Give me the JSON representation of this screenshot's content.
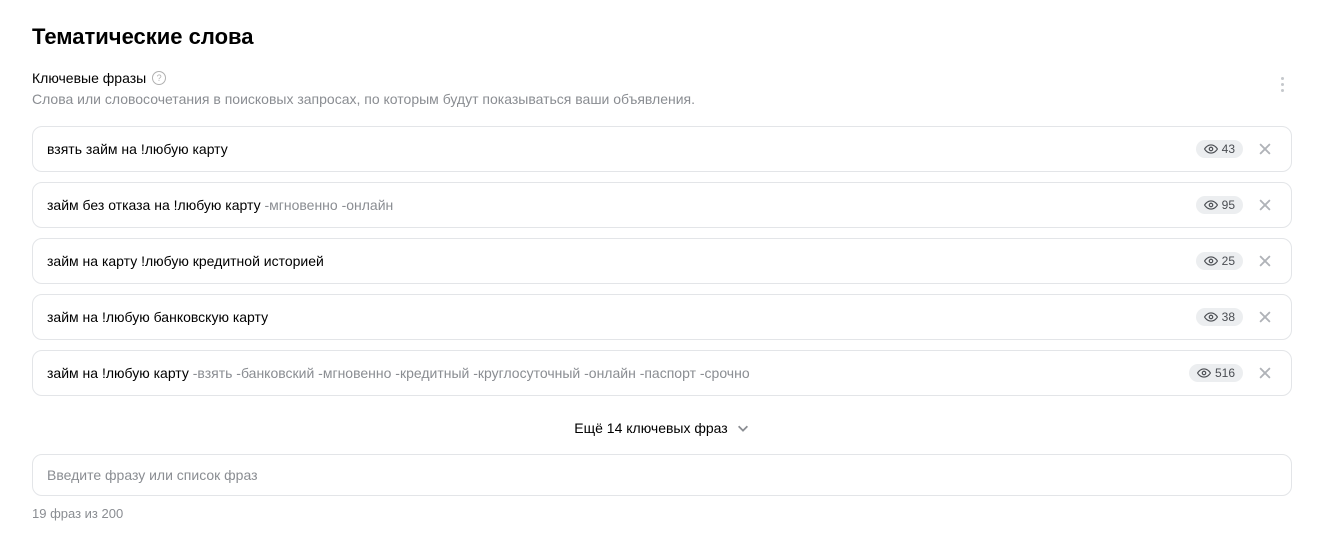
{
  "heading": "Тематические слова",
  "label": "Ключевые фразы",
  "description": "Слова или словосочетания в поисковых запросах, по которым будут показываться ваши объявления.",
  "phrases": [
    {
      "main": "взять займ на !любую карту",
      "neg": "",
      "count": "43"
    },
    {
      "main": "займ без отказа на !любую карту",
      "neg": " -мгновенно -онлайн",
      "count": "95"
    },
    {
      "main": "займ на карту !любую кредитной историей",
      "neg": "",
      "count": "25"
    },
    {
      "main": "займ на !любую банковскую карту",
      "neg": "",
      "count": "38"
    },
    {
      "main": "займ на !любую карту",
      "neg": " -взять -банковский -мгновенно -кредитный -круглосуточный -онлайн -паспорт -срочно",
      "count": "516"
    }
  ],
  "more_label": "Ещё 14 ключевых фраз",
  "input_placeholder": "Введите фразу или список фраз",
  "footer": "19 фраз из 200"
}
